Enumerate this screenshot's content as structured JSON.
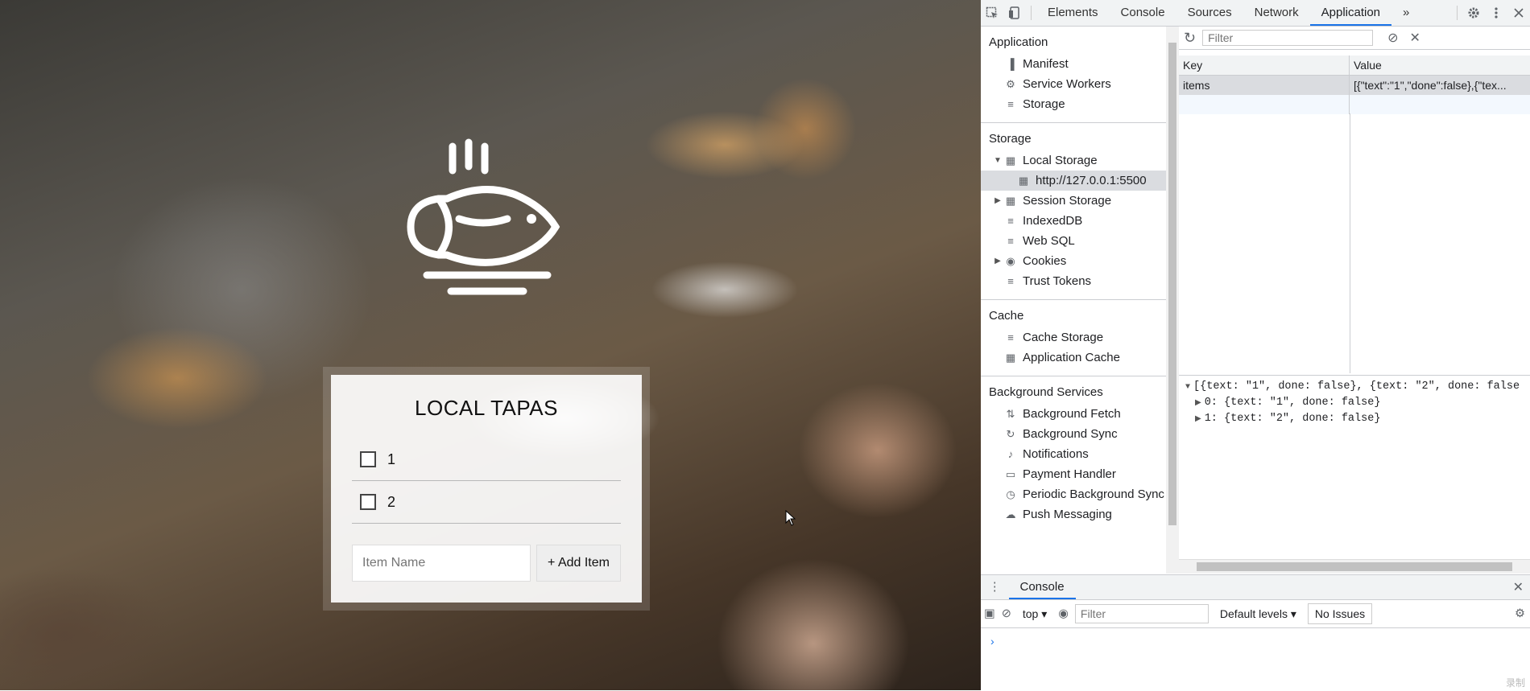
{
  "app": {
    "list_title": "LOCAL TAPAS",
    "items": [
      {
        "text": "1",
        "done": false
      },
      {
        "text": "2",
        "done": false
      }
    ],
    "input_placeholder": "Item Name",
    "add_button_label": "+ Add Item"
  },
  "devtools": {
    "tabs": [
      "Elements",
      "Console",
      "Sources",
      "Network",
      "Application"
    ],
    "active_tab": "Application",
    "more_tabs_glyph": "»",
    "sidebar": {
      "sections": [
        {
          "title": "Application",
          "items": [
            {
              "label": "Manifest",
              "icon": "file-icon"
            },
            {
              "label": "Service Workers",
              "icon": "gear-icon"
            },
            {
              "label": "Storage",
              "icon": "database-icon"
            }
          ]
        },
        {
          "title": "Storage",
          "items": [
            {
              "label": "Local Storage",
              "icon": "grid-icon",
              "expanded": true
            },
            {
              "label": "http://127.0.0.1:5500",
              "icon": "grid-icon",
              "selected": true
            },
            {
              "label": "Session Storage",
              "icon": "grid-icon"
            },
            {
              "label": "IndexedDB",
              "icon": "database-icon"
            },
            {
              "label": "Web SQL",
              "icon": "database-icon"
            },
            {
              "label": "Cookies",
              "icon": "cookie-icon"
            },
            {
              "label": "Trust Tokens",
              "icon": "database-icon"
            }
          ]
        },
        {
          "title": "Cache",
          "items": [
            {
              "label": "Cache Storage",
              "icon": "database-icon"
            },
            {
              "label": "Application Cache",
              "icon": "grid-icon"
            }
          ]
        },
        {
          "title": "Background Services",
          "items": [
            {
              "label": "Background Fetch",
              "icon": "arrows-icon"
            },
            {
              "label": "Background Sync",
              "icon": "sync-icon"
            },
            {
              "label": "Notifications",
              "icon": "bell-icon"
            },
            {
              "label": "Payment Handler",
              "icon": "card-icon"
            },
            {
              "label": "Periodic Background Sync",
              "icon": "clock-icon"
            },
            {
              "label": "Push Messaging",
              "icon": "cloud-icon"
            }
          ]
        }
      ]
    },
    "storage_filter_placeholder": "Filter",
    "table": {
      "headers": [
        "Key",
        "Value"
      ],
      "rows": [
        {
          "key": "items",
          "value": "[{\"text\":\"1\",\"done\":false},{\"tex..."
        }
      ]
    },
    "preview": [
      "[{text: \"1\", done: false}, {text: \"2\", done: false",
      "0: {text: \"1\", done: false}",
      "1: {text: \"2\", done: false}"
    ],
    "drawer": {
      "tab": "Console",
      "context": "top",
      "filter_placeholder": "Filter",
      "levels": "Default levels",
      "issues": "No Issues",
      "prompt": "›"
    },
    "watermark": "录制"
  }
}
